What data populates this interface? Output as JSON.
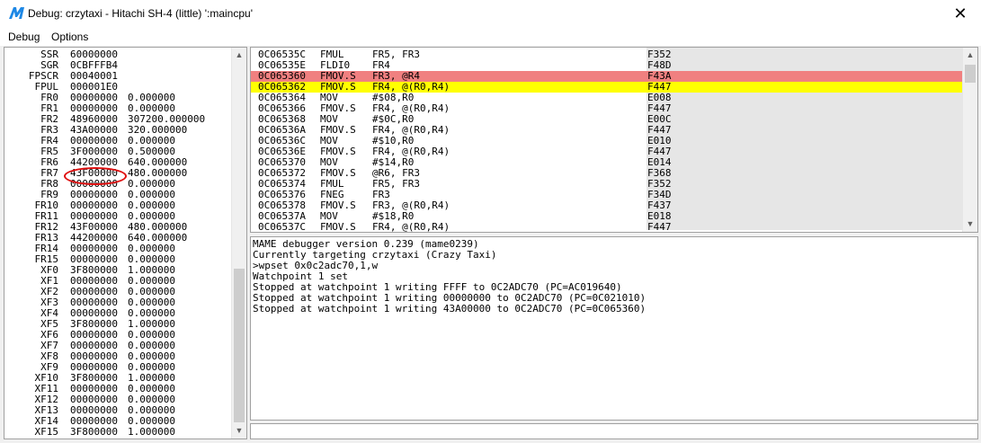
{
  "window": {
    "title": "Debug: crzytaxi - Hitachi SH-4 (little) ':maincpu'",
    "close_glyph": "✕",
    "icon": "mame-logo-icon"
  },
  "menu": {
    "debug": "Debug",
    "options": "Options"
  },
  "registers": [
    {
      "name": "SSR",
      "value": "60000000",
      "float": ""
    },
    {
      "name": "SGR",
      "value": "0CBFFFB4",
      "float": ""
    },
    {
      "name": "FPSCR",
      "value": "00040001",
      "float": ""
    },
    {
      "name": "FPUL",
      "value": "000001E0",
      "float": ""
    },
    {
      "name": "FR0",
      "value": "00000000",
      "float": "0.000000"
    },
    {
      "name": "FR1",
      "value": "00000000",
      "float": "0.000000"
    },
    {
      "name": "FR2",
      "value": "48960000",
      "float": "307200.000000"
    },
    {
      "name": "FR3",
      "value": "43A00000",
      "float": "320.000000"
    },
    {
      "name": "FR4",
      "value": "00000000",
      "float": "0.000000"
    },
    {
      "name": "FR5",
      "value": "3F000000",
      "float": "0.500000"
    },
    {
      "name": "FR6",
      "value": "44200000",
      "float": "640.000000"
    },
    {
      "name": "FR7",
      "value": "43F00000",
      "float": "480.000000"
    },
    {
      "name": "FR8",
      "value": "00000000",
      "float": "0.000000"
    },
    {
      "name": "FR9",
      "value": "00000000",
      "float": "0.000000"
    },
    {
      "name": "FR10",
      "value": "00000000",
      "float": "0.000000"
    },
    {
      "name": "FR11",
      "value": "00000000",
      "float": "0.000000"
    },
    {
      "name": "FR12",
      "value": "43F00000",
      "float": "480.000000"
    },
    {
      "name": "FR13",
      "value": "44200000",
      "float": "640.000000"
    },
    {
      "name": "FR14",
      "value": "00000000",
      "float": "0.000000"
    },
    {
      "name": "FR15",
      "value": "00000000",
      "float": "0.000000"
    },
    {
      "name": "XF0",
      "value": "3F800000",
      "float": "1.000000"
    },
    {
      "name": "XF1",
      "value": "00000000",
      "float": "0.000000"
    },
    {
      "name": "XF2",
      "value": "00000000",
      "float": "0.000000"
    },
    {
      "name": "XF3",
      "value": "00000000",
      "float": "0.000000"
    },
    {
      "name": "XF4",
      "value": "00000000",
      "float": "0.000000"
    },
    {
      "name": "XF5",
      "value": "3F800000",
      "float": "1.000000"
    },
    {
      "name": "XF6",
      "value": "00000000",
      "float": "0.000000"
    },
    {
      "name": "XF7",
      "value": "00000000",
      "float": "0.000000"
    },
    {
      "name": "XF8",
      "value": "00000000",
      "float": "0.000000"
    },
    {
      "name": "XF9",
      "value": "00000000",
      "float": "0.000000"
    },
    {
      "name": "XF10",
      "value": "3F800000",
      "float": "1.000000"
    },
    {
      "name": "XF11",
      "value": "00000000",
      "float": "0.000000"
    },
    {
      "name": "XF12",
      "value": "00000000",
      "float": "0.000000"
    },
    {
      "name": "XF13",
      "value": "00000000",
      "float": "0.000000"
    },
    {
      "name": "XF14",
      "value": "00000000",
      "float": "0.000000"
    },
    {
      "name": "XF15",
      "value": "3F800000",
      "float": "1.000000"
    }
  ],
  "disassembly": [
    {
      "addr": "0C06535C",
      "op": "FMUL",
      "args": "FR5, FR3",
      "hex": "F352",
      "state": "normal"
    },
    {
      "addr": "0C06535E",
      "op": "FLDI0",
      "args": "FR4",
      "hex": "F48D",
      "state": "normal"
    },
    {
      "addr": "0C065360",
      "op": "FMOV.S",
      "args": "FR3, @R4",
      "hex": "F43A",
      "state": "breakpoint"
    },
    {
      "addr": "0C065362",
      "op": "FMOV.S",
      "args": "FR4, @(R0,R4)",
      "hex": "F447",
      "state": "current"
    },
    {
      "addr": "0C065364",
      "op": "MOV",
      "args": "#$08,R0",
      "hex": "E008",
      "state": "normal"
    },
    {
      "addr": "0C065366",
      "op": "FMOV.S",
      "args": "FR4, @(R0,R4)",
      "hex": "F447",
      "state": "normal"
    },
    {
      "addr": "0C065368",
      "op": "MOV",
      "args": "#$0C,R0",
      "hex": "E00C",
      "state": "normal"
    },
    {
      "addr": "0C06536A",
      "op": "FMOV.S",
      "args": "FR4, @(R0,R4)",
      "hex": "F447",
      "state": "normal"
    },
    {
      "addr": "0C06536C",
      "op": "MOV",
      "args": "#$10,R0",
      "hex": "E010",
      "state": "normal"
    },
    {
      "addr": "0C06536E",
      "op": "FMOV.S",
      "args": "FR4, @(R0,R4)",
      "hex": "F447",
      "state": "normal"
    },
    {
      "addr": "0C065370",
      "op": "MOV",
      "args": "#$14,R0",
      "hex": "E014",
      "state": "normal"
    },
    {
      "addr": "0C065372",
      "op": "FMOV.S",
      "args": "@R6, FR3",
      "hex": "F368",
      "state": "normal"
    },
    {
      "addr": "0C065374",
      "op": "FMUL",
      "args": "FR5, FR3",
      "hex": "F352",
      "state": "normal"
    },
    {
      "addr": "0C065376",
      "op": "FNEG",
      "args": "FR3",
      "hex": "F34D",
      "state": "normal"
    },
    {
      "addr": "0C065378",
      "op": "FMOV.S",
      "args": "FR3, @(R0,R4)",
      "hex": "F437",
      "state": "normal"
    },
    {
      "addr": "0C06537A",
      "op": "MOV",
      "args": "#$18,R0",
      "hex": "E018",
      "state": "normal"
    },
    {
      "addr": "0C06537C",
      "op": "FMOV.S",
      "args": "FR4, @(R0,R4)",
      "hex": "F447",
      "state": "normal"
    }
  ],
  "console": [
    "MAME debugger version 0.239 (mame0239)",
    "Currently targeting crzytaxi (Crazy Taxi)",
    ">wpset 0x0c2adc70,1,w",
    "Watchpoint 1 set",
    "Stopped at watchpoint 1 writing FFFF to 0C2ADC70 (PC=AC019640)",
    "Stopped at watchpoint 1 writing 00000000 to 0C2ADC70 (PC=0C021010)",
    "Stopped at watchpoint 1 writing 43A00000 to 0C2ADC70 (PC=0C065360)"
  ],
  "colors": {
    "breakpoint": "#f08080",
    "current": "#ffff00",
    "annotation": "#e01010",
    "accent": "#1e88e5"
  },
  "scroll_arrows": {
    "up": "▲",
    "down": "▼"
  }
}
